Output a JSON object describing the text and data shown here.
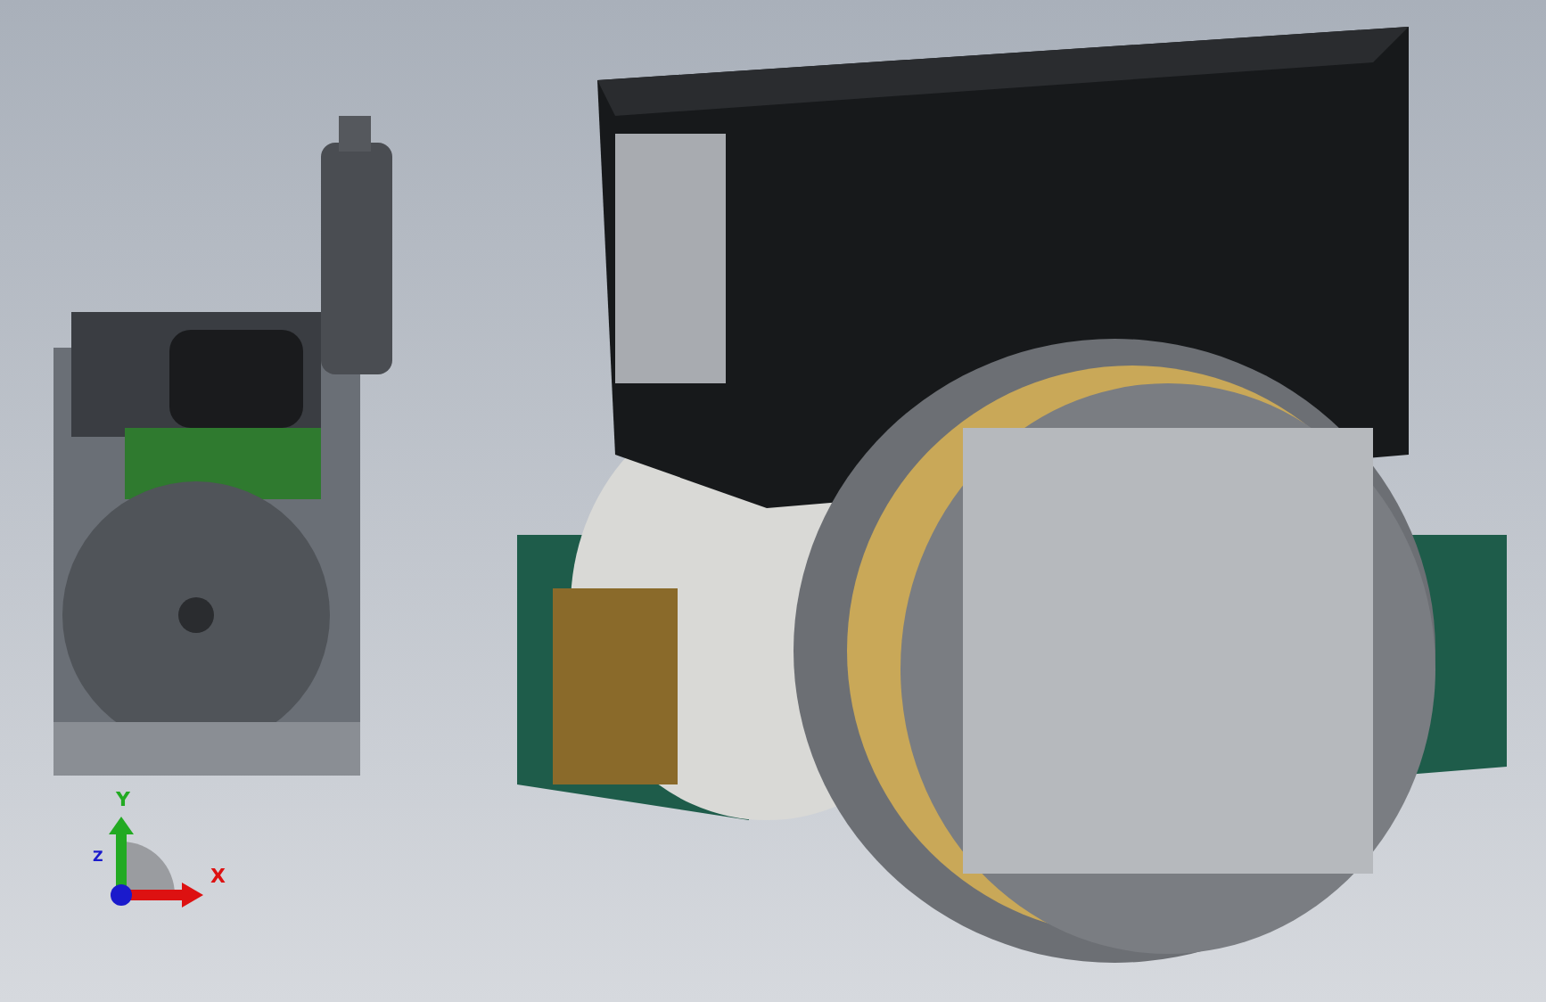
{
  "viewport": {
    "models": [
      {
        "kind": "engine"
      },
      {
        "kind": "generator"
      }
    ],
    "triad": {
      "axes": [
        {
          "label": "Y",
          "color": "#22aa22"
        },
        {
          "label": "X",
          "color": "#dd1111"
        },
        {
          "label": "Z",
          "color": "#1a1acc"
        }
      ]
    }
  }
}
